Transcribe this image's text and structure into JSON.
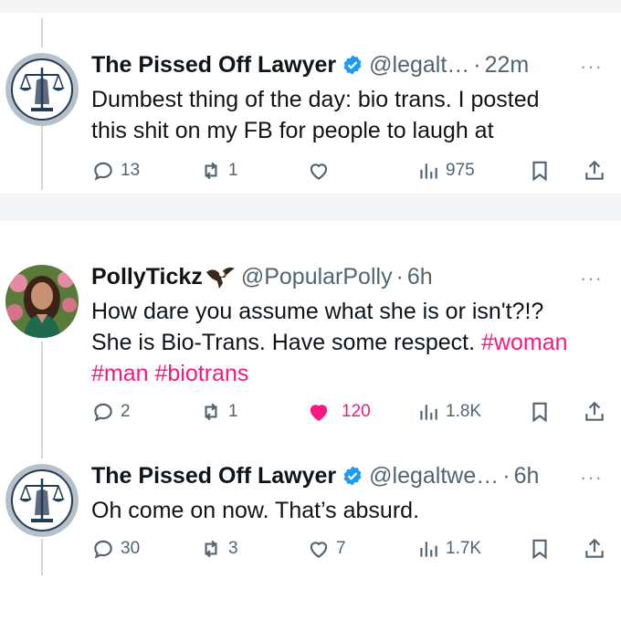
{
  "tweets": [
    {
      "name": "The Pissed Off Lawyer",
      "verified": true,
      "handle": "@legalt…",
      "separator": "·",
      "time": "22m",
      "more": "···",
      "avatar": "scales-of-justice-logo",
      "text_lines": [
        "Dumbest thing of the day: bio trans. I posted",
        "this shit on my FB for people to laugh at"
      ],
      "stats": {
        "replies": "13",
        "reposts": "1",
        "likes": "",
        "views": "975"
      }
    },
    {
      "name": "PollyTickz",
      "name_emoji": "eagle",
      "verified": false,
      "handle": "@PopularPolly",
      "separator": "·",
      "time": "6h",
      "more": "···",
      "avatar": "profile-photo",
      "text_line1": "How dare you assume what she is or isn't?!?",
      "text_line2_plain": "She is Bio-Trans. Have some respect. ",
      "hashtags": [
        "#woman",
        "#man",
        "#biotrans"
      ],
      "stats": {
        "replies": "2",
        "reposts": "1",
        "likes": "120",
        "views": "1.8K"
      },
      "liked": true
    },
    {
      "name": "The Pissed Off Lawyer",
      "verified": true,
      "handle": "@legaltwe…",
      "separator": "·",
      "time": "6h",
      "more": "···",
      "avatar": "scales-of-justice-logo",
      "text": "Oh come on now. That’s absurd.",
      "stats": {
        "replies": "30",
        "reposts": "3",
        "likes": "7",
        "views": "1.7K"
      }
    }
  ],
  "colors": {
    "text": "#0f1419",
    "secondary": "#536471",
    "verified": "#1d9bf0",
    "hashtag": "#f91880",
    "like": "#f91880"
  }
}
